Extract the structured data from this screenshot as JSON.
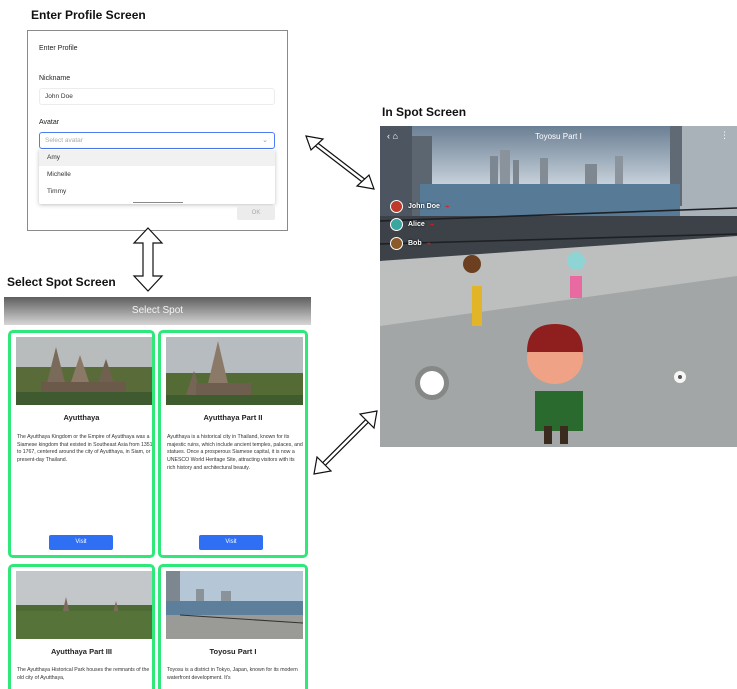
{
  "sections": {
    "profile": "Enter Profile Screen",
    "in_spot": "In Spot Screen",
    "select_spot": "Select Spot Screen"
  },
  "profile": {
    "header": "Enter Profile",
    "nickname_label": "Nickname",
    "nickname_value": "John Doe",
    "avatar_label": "Avatar",
    "avatar_placeholder": "Select avatar",
    "options": [
      "Amy",
      "Michelle",
      "Timmy"
    ],
    "ok_label": "OK"
  },
  "select_spot": {
    "title": "Select Spot",
    "cards": [
      {
        "name": "Ayutthaya",
        "description": "The Ayutthaya Kingdom or the Empire of Ayutthaya was a Siamese kingdom that existed in Southeast Asia from 1351 to 1767, centered around the city of Ayutthaya, in Siam, or present-day Thailand.",
        "visit": "Visit"
      },
      {
        "name": "Ayutthaya Part II",
        "description": "Ayutthaya is a historical city in Thailand, known for its majestic ruins, which include ancient temples, palaces, and statues. Once a prosperous Siamese capital, it is now a UNESCO World Heritage Site, attracting visitors with its rich history and architectural beauty.",
        "visit": "Visit"
      },
      {
        "name": "Ayutthaya Part III",
        "description": "The Ayutthaya Historical Park houses the remnants of the old city of Ayutthaya,"
      },
      {
        "name": "Toyosu Part I",
        "description": "Toyosu is a district in Tokyo, Japan, known for its modern waterfront development. It's"
      }
    ]
  },
  "in_spot": {
    "title": "Toyosu Part I",
    "back": "‹",
    "menu": "⋮",
    "players": [
      {
        "name": "John Doe",
        "color": "#c0392b"
      },
      {
        "name": "Alice",
        "color": "#3aa6a0"
      },
      {
        "name": "Bob",
        "color": "#8a5a2b"
      }
    ],
    "mic_icon": "mic-muted-icon"
  },
  "colors": {
    "card_border": "#2ee87a",
    "visit_button": "#2f6ff3",
    "select_focus": "#4f7df5",
    "mic_muted": "#e21a1a"
  }
}
